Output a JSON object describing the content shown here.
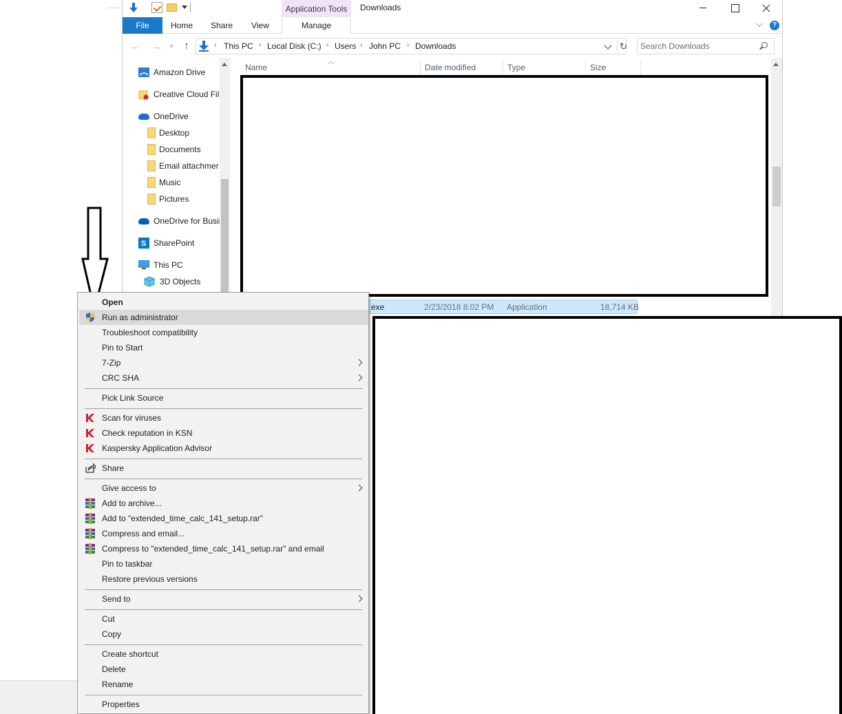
{
  "window": {
    "title": "Downloads",
    "context_tab_header": "Application Tools",
    "ribbon_tabs": [
      "File",
      "Home",
      "Share",
      "View",
      "Manage"
    ]
  },
  "address": {
    "crumbs": [
      "This PC",
      "Local Disk (C:)",
      "Users",
      "John PC",
      "Downloads"
    ],
    "search_placeholder": "Search Downloads"
  },
  "nav_pane": {
    "items": [
      {
        "label": "Amazon Drive",
        "icon": "amazon-drive-icon"
      },
      {
        "label": "Creative Cloud Fil",
        "icon": "creative-cloud-icon"
      },
      {
        "label": "OneDrive",
        "icon": "onedrive-icon"
      },
      {
        "label": "Desktop",
        "icon": "folder-icon"
      },
      {
        "label": "Documents",
        "icon": "folder-icon"
      },
      {
        "label": "Email attachmer",
        "icon": "folder-icon"
      },
      {
        "label": "Music",
        "icon": "folder-icon"
      },
      {
        "label": "Pictures",
        "icon": "folder-icon"
      },
      {
        "label": "OneDrive for Busii",
        "icon": "onedrive-business-icon"
      },
      {
        "label": "SharePoint",
        "icon": "sharepoint-icon"
      },
      {
        "label": "This PC",
        "icon": "this-pc-icon"
      },
      {
        "label": "3D Objects",
        "icon": "3d-objects-icon"
      }
    ]
  },
  "columns": [
    "Name",
    "Date modified",
    "Type",
    "Size"
  ],
  "selected_file": {
    "name_suffix": "exe",
    "date_modified": "2/23/2018 8:02 PM",
    "type": "Application",
    "size": "18,714 KB"
  },
  "context_menu": {
    "items": {
      "open": "Open",
      "run_as_admin": "Run as administrator",
      "troubleshoot": "Troubleshoot compatibility",
      "pin_start": "Pin to Start",
      "seven_zip": "7-Zip",
      "crc_sha": "CRC SHA",
      "pick_link": "Pick Link Source",
      "scan_viruses": "Scan for viruses",
      "check_ksn": "Check reputation in KSN",
      "kaspersky_advisor": "Kaspersky Application Advisor",
      "share": "Share",
      "give_access": "Give access to",
      "add_archive": "Add to archive...",
      "add_rar": "Add to \"extended_time_calc_141_setup.rar\"",
      "compress_email": "Compress and email...",
      "compress_rar_email": "Compress to \"extended_time_calc_141_setup.rar\" and email",
      "pin_taskbar": "Pin to taskbar",
      "restore_versions": "Restore previous versions",
      "send_to": "Send to",
      "cut": "Cut",
      "copy": "Copy",
      "create_shortcut": "Create shortcut",
      "delete": "Delete",
      "rename": "Rename",
      "properties": "Properties"
    }
  },
  "colors": {
    "accent": "#1979ca",
    "context_tab": "#f1e3f7",
    "selection": "#cce8ff",
    "menu_bg": "#f2f2f2",
    "menu_highlight": "#dadada"
  }
}
